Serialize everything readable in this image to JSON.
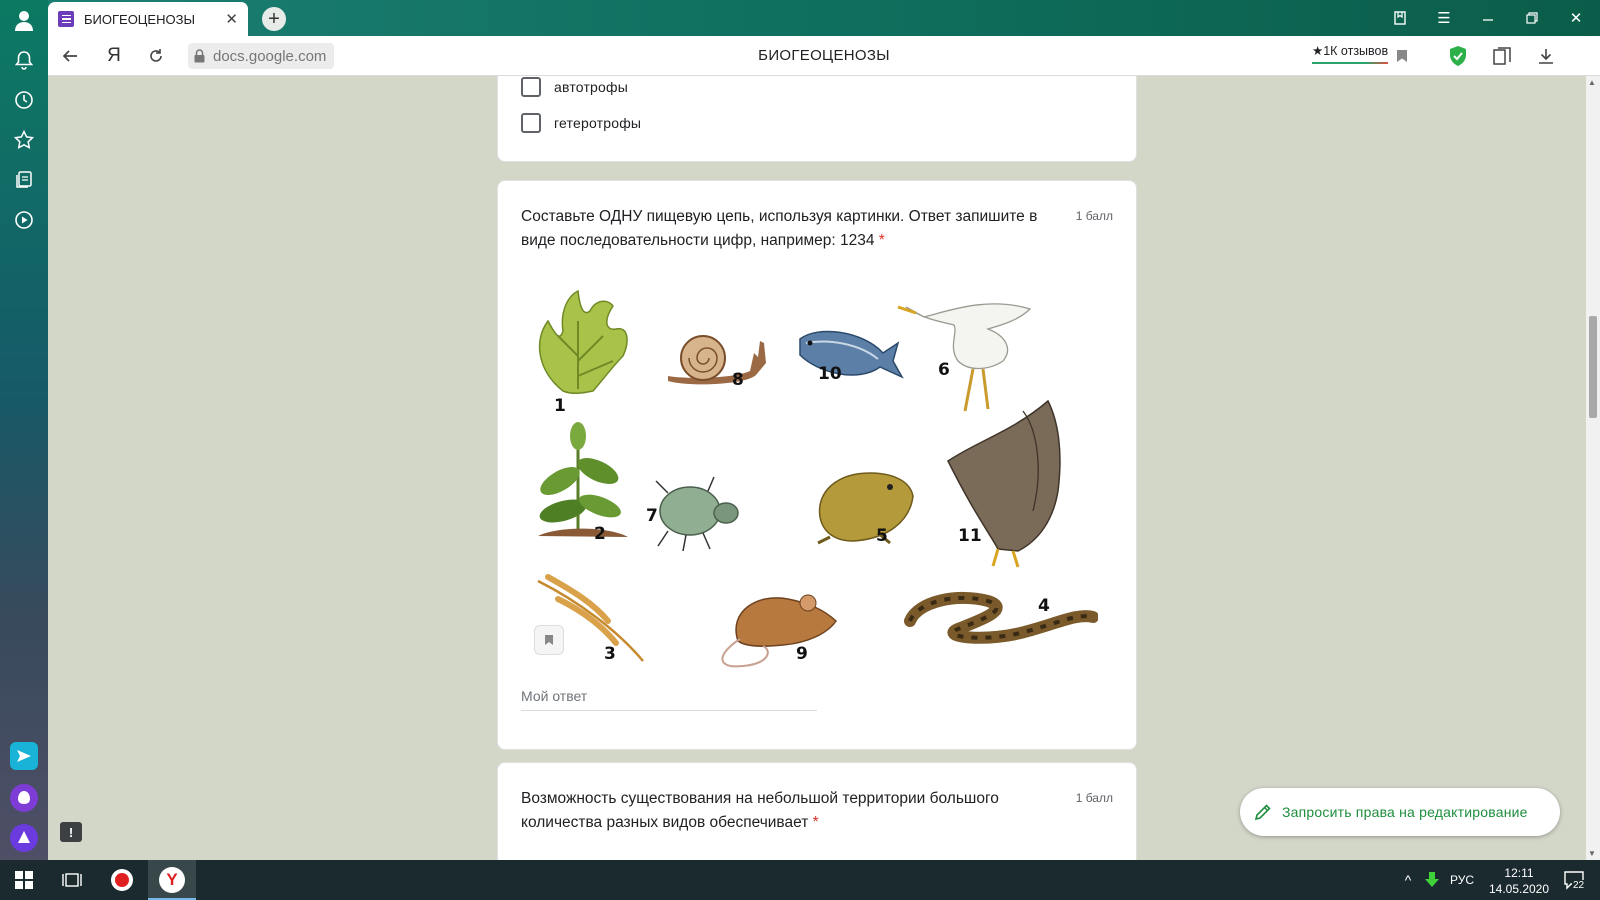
{
  "browser": {
    "tab_title": "БИОГЕОЦЕНОЗЫ",
    "url": "docs.google.com",
    "page_title": "БИОГЕОЦЕНОЗЫ",
    "reviews_badge": "★1К отзывов"
  },
  "form": {
    "prev_question": {
      "options": [
        "автотрофы",
        "гетеротрофы"
      ]
    },
    "question_food_chain": {
      "text": "Составьте ОДНУ пищевую цепь, используя картинки. Ответ запишите в виде последовательности цифр, например: 1234",
      "required_mark": "*",
      "points": "1 балл",
      "image_numbers": {
        "algae": "1",
        "snail": "8",
        "fish": "10",
        "heron": "6",
        "plant": "2",
        "beetle": "7",
        "toad": "5",
        "eagle": "11",
        "wheat": "3",
        "mouse": "9",
        "snake": "4"
      },
      "answer_placeholder": "Мой ответ"
    },
    "question_next": {
      "text": "Возможность существования на небольшой территории большого количества разных видов обеспечивает",
      "required_mark": "*",
      "points": "1 балл"
    },
    "request_edit_label": "Запросить права на редактирование",
    "feedback_label": "!"
  },
  "taskbar": {
    "language": "РУС",
    "time": "12:11",
    "date": "14.05.2020",
    "notifications_count": "22"
  },
  "colors": {
    "sidebar": "#0c7a63",
    "form_background": "#d3d7c8",
    "required": "#d93025",
    "edit_button_text": "#1e8e3e"
  }
}
